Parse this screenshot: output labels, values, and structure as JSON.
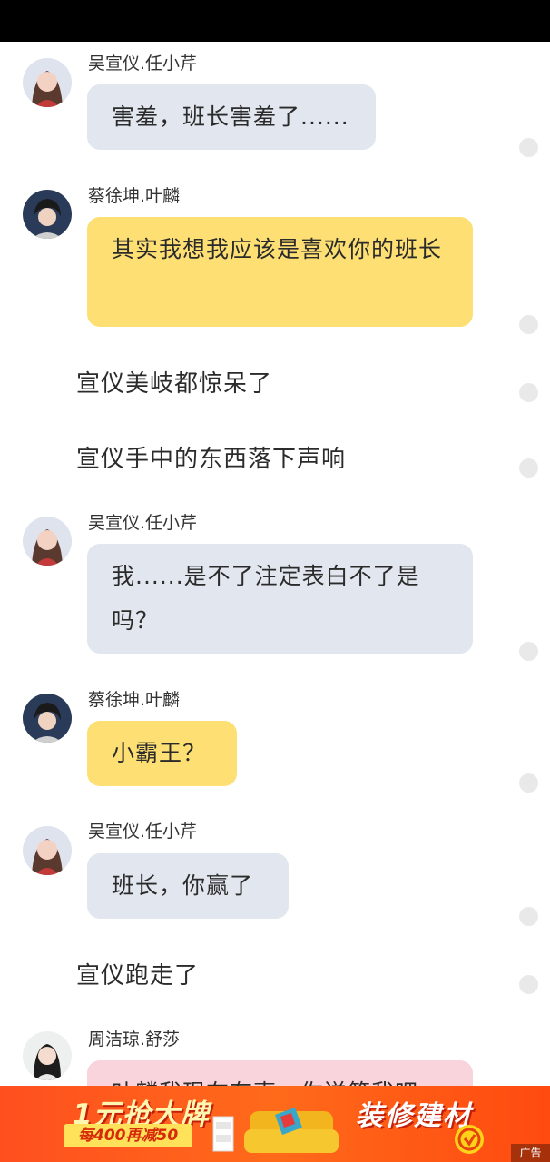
{
  "messages": [
    {
      "type": "chat",
      "sender": "吴宣仪.任小芹",
      "text": "害羞，班长害羞了......",
      "color": "gray"
    },
    {
      "type": "chat",
      "sender": "蔡徐坤.叶麟",
      "text": "其实我想我应该是喜欢你的班长",
      "color": "yellow"
    },
    {
      "type": "narration",
      "text": "宣仪美岐都惊呆了"
    },
    {
      "type": "narration",
      "text": "宣仪手中的东西落下声响"
    },
    {
      "type": "chat",
      "sender": "吴宣仪.任小芹",
      "text": "我......是不了注定表白不了是吗？",
      "color": "gray"
    },
    {
      "type": "chat",
      "sender": "蔡徐坤.叶麟",
      "text": "小霸王？",
      "color": "yellow"
    },
    {
      "type": "chat",
      "sender": "吴宣仪.任小芹",
      "text": "班长，你赢了",
      "color": "gray"
    },
    {
      "type": "narration",
      "text": "宣仪跑走了"
    },
    {
      "type": "chat",
      "sender": "周洁琼.舒莎",
      "text": "叶麟我现在有事，你送第我吧",
      "color": "pink"
    }
  ],
  "ad": {
    "left_title": "1元抢大牌",
    "left_sub": "每400再减50",
    "right_title": "装修建材",
    "badge": "广告"
  },
  "colors": {
    "bubble_gray": "#e2e7ef",
    "bubble_yellow": "#fddf74",
    "bubble_pink": "#fad4dc",
    "ad_orange": "#ff5a1a"
  }
}
